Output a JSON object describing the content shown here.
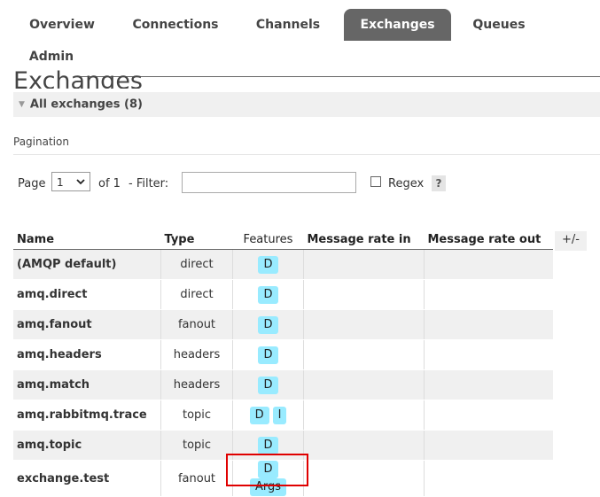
{
  "nav": {
    "tabs": [
      {
        "label": "Overview",
        "active": false
      },
      {
        "label": "Connections",
        "active": false
      },
      {
        "label": "Channels",
        "active": false
      },
      {
        "label": "Exchanges",
        "active": true
      },
      {
        "label": "Queues",
        "active": false
      },
      {
        "label": "Admin",
        "active": false
      }
    ]
  },
  "page": {
    "title": "Exchanges",
    "section_label": "All exchanges (8)"
  },
  "pagination": {
    "heading": "Pagination",
    "page_label": "Page",
    "page_value": "1",
    "of_label": "of 1",
    "filter_label": "- Filter:",
    "filter_value": "",
    "regex_label": "Regex",
    "regex_checked": false,
    "help_label": "?"
  },
  "table": {
    "headers": [
      "Name",
      "Type",
      "Features",
      "Message rate in",
      "Message rate out"
    ],
    "toggle_columns_label": "+/-",
    "rows": [
      {
        "name": "(AMQP default)",
        "type": "direct",
        "features": [
          "D"
        ],
        "rate_in": "",
        "rate_out": ""
      },
      {
        "name": "amq.direct",
        "type": "direct",
        "features": [
          "D"
        ],
        "rate_in": "",
        "rate_out": ""
      },
      {
        "name": "amq.fanout",
        "type": "fanout",
        "features": [
          "D"
        ],
        "rate_in": "",
        "rate_out": ""
      },
      {
        "name": "amq.headers",
        "type": "headers",
        "features": [
          "D"
        ],
        "rate_in": "",
        "rate_out": ""
      },
      {
        "name": "amq.match",
        "type": "headers",
        "features": [
          "D"
        ],
        "rate_in": "",
        "rate_out": ""
      },
      {
        "name": "amq.rabbitmq.trace",
        "type": "topic",
        "features": [
          "D",
          "I"
        ],
        "rate_in": "",
        "rate_out": ""
      },
      {
        "name": "amq.topic",
        "type": "topic",
        "features": [
          "D"
        ],
        "rate_in": "",
        "rate_out": ""
      },
      {
        "name": "exchange.test",
        "type": "fanout",
        "features": [
          "D",
          "Args"
        ],
        "rate_in": "",
        "rate_out": ""
      }
    ]
  },
  "colors": {
    "active_tab": "#666666",
    "feature_badge": "#99ebff",
    "highlight": "#e00000"
  }
}
